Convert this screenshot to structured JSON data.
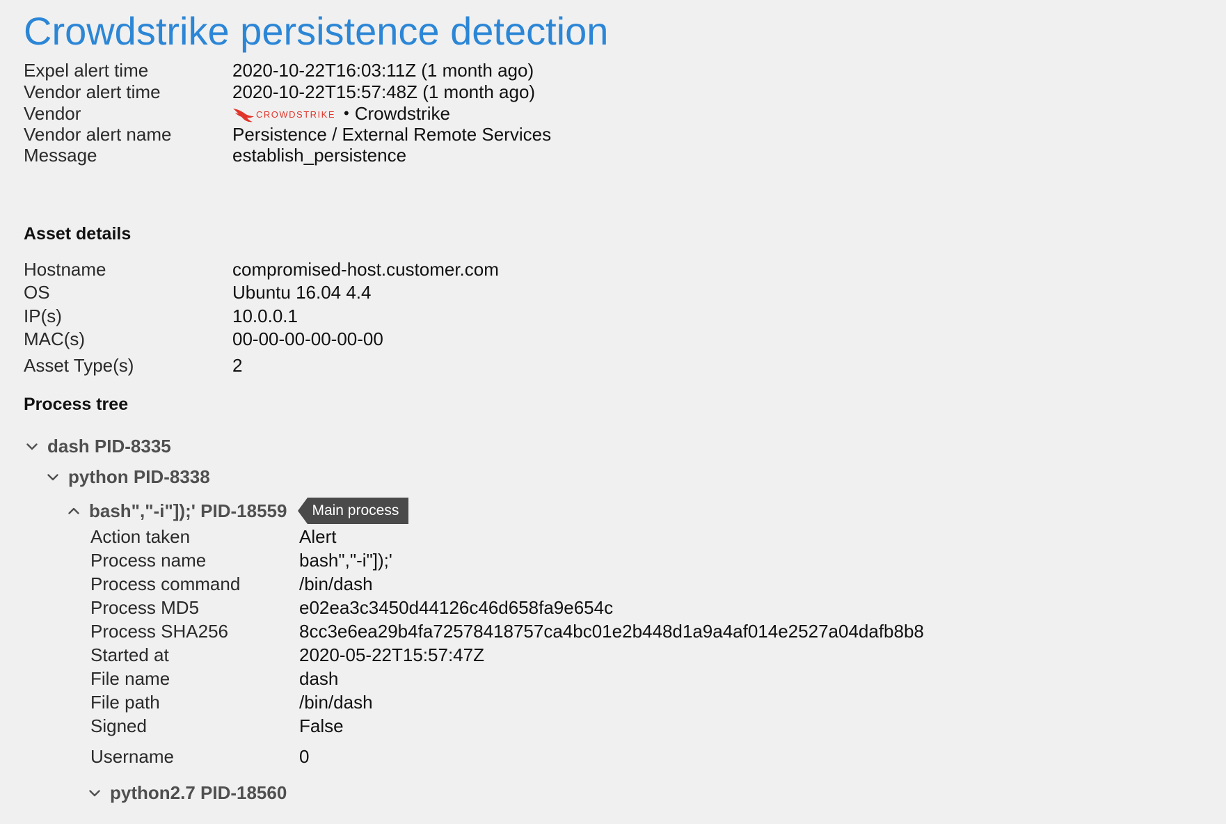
{
  "title": "Crowdstrike persistence detection",
  "alert": [
    {
      "label": "Expel alert time",
      "value": "2020-10-22T16:03:11Z (1 month ago)"
    },
    {
      "label": "Vendor alert time",
      "value": "2020-10-22T15:57:48Z (1 month ago)"
    },
    {
      "label": "Vendor",
      "value": "Crowdstrike",
      "logo_text": "CROWDSTRIKE",
      "logo_icon": "falcon-logo-icon"
    },
    {
      "label": "Vendor alert name",
      "value": "Persistence / External Remote Services"
    },
    {
      "label": "Message",
      "value": "establish_persistence"
    }
  ],
  "asset": {
    "heading": "Asset details",
    "rows": [
      {
        "label": "Hostname",
        "value": "compromised-host.customer.com"
      },
      {
        "label": "OS",
        "value": "Ubuntu 16.04 4.4"
      },
      {
        "label": "IP(s)",
        "value": "10.0.0.1"
      },
      {
        "label": "MAC(s)",
        "value": "00-00-00-00-00-00"
      },
      {
        "label": "Asset Type(s)",
        "value": "2"
      }
    ]
  },
  "process_tree": {
    "heading": "Process tree",
    "nodes": [
      {
        "label": "dash PID-8335",
        "expanded": true
      },
      {
        "label": "python PID-8338",
        "expanded": true
      },
      {
        "label": "bash\",\"-i\"]);' PID-18559",
        "expanded": true,
        "badge": "Main process"
      },
      {
        "label": "python2.7 PID-18560",
        "expanded": false
      }
    ],
    "main_process_details": [
      {
        "label": "Action taken",
        "value": "Alert"
      },
      {
        "label": "Process name",
        "value": "bash\",\"-i\"]);'"
      },
      {
        "label": "Process command",
        "value": "/bin/dash"
      },
      {
        "label": "Process MD5",
        "value": "e02ea3c3450d44126c46d658fa9e654c"
      },
      {
        "label": "Process SHA256",
        "value": "8cc3e6ea29b4fa72578418757ca4bc01e2b448d1a9a4af014e2527a04dafb8b8"
      },
      {
        "label": "Started at",
        "value": "2020-05-22T15:57:47Z"
      },
      {
        "label": "File name",
        "value": "dash"
      },
      {
        "label": "File path",
        "value": "/bin/dash"
      },
      {
        "label": "Signed",
        "value": "False"
      },
      {
        "label": "Username",
        "value": "0"
      }
    ]
  },
  "colors": {
    "title": "#2c86d6",
    "logo": "#e0352b",
    "badge": "#4a4a4a"
  }
}
